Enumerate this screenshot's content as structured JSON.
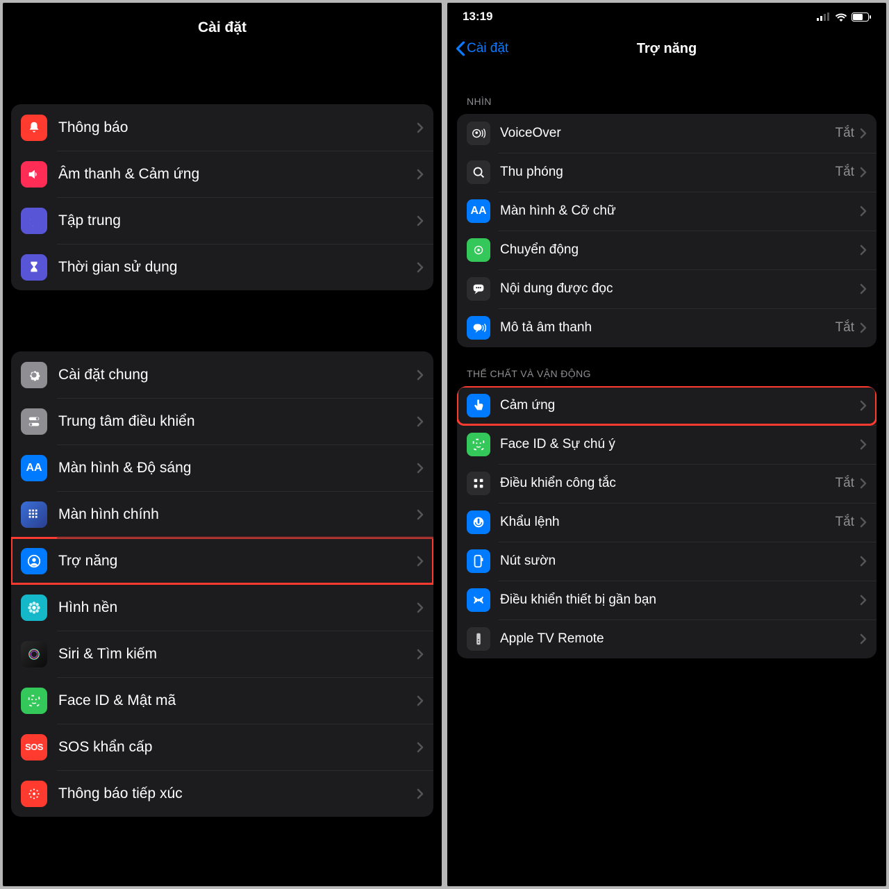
{
  "left": {
    "title": "Cài đặt",
    "groups": [
      {
        "rows": [
          {
            "id": "notifications",
            "label": "Thông báo",
            "icon": "bell",
            "color": "bg-red"
          },
          {
            "id": "sounds",
            "label": "Âm thanh & Cảm ứng",
            "icon": "speaker",
            "color": "bg-pink"
          },
          {
            "id": "focus",
            "label": "Tập trung",
            "icon": "moon",
            "color": "bg-indigo"
          },
          {
            "id": "screentime",
            "label": "Thời gian sử dụng",
            "icon": "hourglass",
            "color": "bg-indigo"
          }
        ]
      },
      {
        "rows": [
          {
            "id": "general",
            "label": "Cài đặt chung",
            "icon": "gear",
            "color": "bg-gray"
          },
          {
            "id": "controlcenter",
            "label": "Trung tâm điều khiển",
            "icon": "switches",
            "color": "bg-gray"
          },
          {
            "id": "display",
            "label": "Màn hình & Độ sáng",
            "icon": "aa",
            "color": "bg-blue"
          },
          {
            "id": "homescreen",
            "label": "Màn hình chính",
            "icon": "grid",
            "color": "bg-home"
          },
          {
            "id": "accessibility",
            "label": "Trợ năng",
            "icon": "person-circle",
            "color": "bg-blue",
            "highlighted": true
          },
          {
            "id": "wallpaper",
            "label": "Hình nền",
            "icon": "flower",
            "color": "bg-cyan"
          },
          {
            "id": "siri",
            "label": "Siri & Tìm kiếm",
            "icon": "siri",
            "color": "bg-siri"
          },
          {
            "id": "faceid",
            "label": "Face ID & Mật mã",
            "icon": "face",
            "color": "bg-green"
          },
          {
            "id": "sos",
            "label": "SOS khẩn cấp",
            "icon": "sos",
            "color": "bg-red"
          },
          {
            "id": "exposure",
            "label": "Thông báo tiếp xúc",
            "icon": "dots",
            "color": "bg-red"
          }
        ]
      }
    ]
  },
  "right": {
    "time": "13:19",
    "back": "Cài đặt",
    "title": "Trợ năng",
    "sections": [
      {
        "header": "NHÌN",
        "rows": [
          {
            "id": "voiceover",
            "label": "VoiceOver",
            "value": "Tắt",
            "icon": "voiceover",
            "color": "bg-dark"
          },
          {
            "id": "zoom",
            "label": "Thu phóng",
            "value": "Tắt",
            "icon": "zoom",
            "color": "bg-dark"
          },
          {
            "id": "display-text",
            "label": "Màn hình & Cỡ chữ",
            "icon": "aa",
            "color": "bg-blue"
          },
          {
            "id": "motion",
            "label": "Chuyển động",
            "icon": "motion",
            "color": "bg-green"
          },
          {
            "id": "spoken",
            "label": "Nội dung được đọc",
            "icon": "speech",
            "color": "bg-dark"
          },
          {
            "id": "audio-desc",
            "label": "Mô tả âm thanh",
            "value": "Tắt",
            "icon": "audio-desc",
            "color": "bg-blue"
          }
        ]
      },
      {
        "header": "THỂ CHẤT VÀ VẬN ĐỘNG",
        "rows": [
          {
            "id": "touch",
            "label": "Cảm ứng",
            "icon": "touch",
            "color": "bg-blue",
            "highlighted": true
          },
          {
            "id": "face-attention",
            "label": "Face ID & Sự chú ý",
            "icon": "face",
            "color": "bg-green"
          },
          {
            "id": "switch-control",
            "label": "Điều khiển công tắc",
            "value": "Tắt",
            "icon": "switch",
            "color": "bg-dark"
          },
          {
            "id": "voice-control",
            "label": "Khẩu lệnh",
            "value": "Tắt",
            "icon": "voice",
            "color": "bg-blue"
          },
          {
            "id": "side-button",
            "label": "Nút sườn",
            "icon": "button",
            "color": "bg-blue"
          },
          {
            "id": "nearby",
            "label": "Điều khiển thiết bị gần bạn",
            "icon": "nearby",
            "color": "bg-blue"
          },
          {
            "id": "appletv",
            "label": "Apple TV Remote",
            "icon": "remote",
            "color": "bg-dark"
          }
        ]
      }
    ]
  }
}
